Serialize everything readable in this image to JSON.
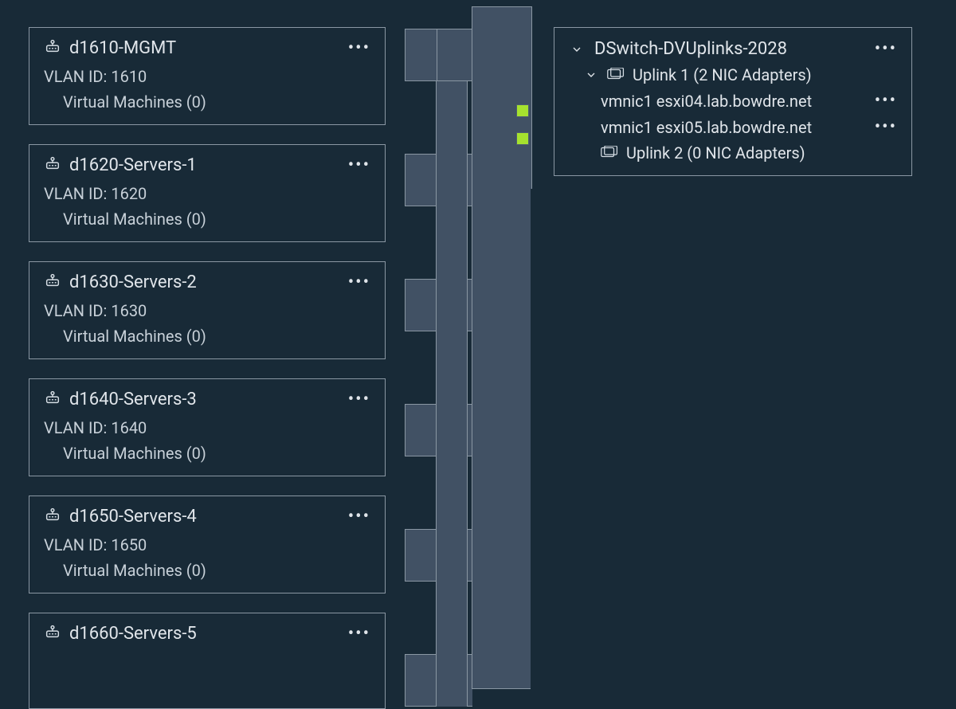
{
  "portgroups": [
    {
      "name": "d1610-MGMT",
      "vlan": "VLAN ID: 1610",
      "vms": "Virtual Machines (0)"
    },
    {
      "name": "d1620-Servers-1",
      "vlan": "VLAN ID: 1620",
      "vms": "Virtual Machines (0)"
    },
    {
      "name": "d1630-Servers-2",
      "vlan": "VLAN ID: 1630",
      "vms": "Virtual Machines (0)"
    },
    {
      "name": "d1640-Servers-3",
      "vlan": "VLAN ID: 1640",
      "vms": "Virtual Machines (0)"
    },
    {
      "name": "d1650-Servers-4",
      "vlan": "VLAN ID: 1650",
      "vms": "Virtual Machines (0)"
    },
    {
      "name": "d1660-Servers-5",
      "vlan": "",
      "vms": ""
    }
  ],
  "uplink": {
    "title": "DSwitch-DVUplinks-2028",
    "u1_label": "Uplink 1 (2 NIC Adapters)",
    "nic1": "vmnic1 esxi04.lab.bowdre.net",
    "nic2": "vmnic1 esxi05.lab.bowdre.net",
    "u2_label": "Uplink 2 (0 NIC Adapters)"
  },
  "glyphs": {
    "kebab": "•••"
  }
}
